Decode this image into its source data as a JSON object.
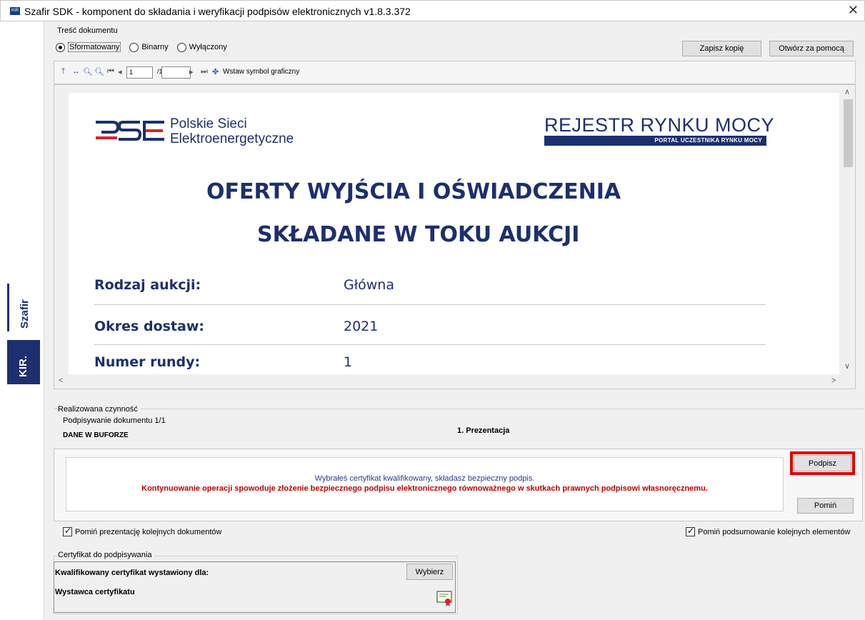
{
  "window": {
    "title": "Szafir SDK - komponent do składania i weryfikacji podpisów elektronicznych v1.8.3.372",
    "icon_label": "KIR"
  },
  "brand": {
    "szafir": "Szafir",
    "kir": "KIR."
  },
  "document_content": {
    "group_label": "Treść dokumentu",
    "modes": [
      {
        "label": "Sformatowany",
        "selected": true
      },
      {
        "label": "Binarny",
        "selected": false
      },
      {
        "label": "Wyłączony",
        "selected": false
      }
    ],
    "save_copy_label": "Zapisz kopię",
    "open_with_label": "Otwórz za pomocą"
  },
  "toolbar": {
    "page_current": "1",
    "page_total": "/1",
    "insert_symbol_label": "Wstaw symbol graficzny"
  },
  "document": {
    "pse_line1": "Polskie Sieci",
    "pse_line2": "Elektroenergetyczne",
    "rrm_title": "REJESTR RYNKU MOCY",
    "rrm_subtitle": "PORTAL UCZESTNIKA RYNKU MOCY",
    "heading1": "OFERTY WYJŚCIA I OŚWIADCZENIA",
    "heading2": "SKŁADANE W TOKU AUKCJI",
    "rows": [
      {
        "label": "Rodzaj aukcji:",
        "value": "Główna"
      },
      {
        "label": "Okres dostaw:",
        "value": "2021"
      },
      {
        "label": "Numer rundy:",
        "value": "1"
      }
    ]
  },
  "activity": {
    "group_label": "Realizowana czynność",
    "progress_text": "Podpisywanie dokumentu 1/1",
    "buffer_label": "DANE W BUFORZE",
    "step_label": "1. Prezentacja",
    "message_line1": "Wybrałeś certyfikat kwalifikowany, składasz bezpieczny podpis.",
    "message_line2": "Kontynuowanie operacji spowoduje złożenie bezpiecznego podpisu elektronicznego równoważnego w skutkach prawnych podpisowi własnoręcznemu.",
    "sign_label": "Podpisz",
    "skip_label": "Pomiń"
  },
  "options": {
    "skip_presentation_label": "Pomiń prezentację kolejnych dokumentów",
    "skip_presentation_checked": true,
    "skip_summary_label": "Pomiń podsumowanie kolejnych elementów",
    "skip_summary_checked": true
  },
  "certificate": {
    "group_label": "Certyfikat do podpisywania",
    "issued_for_label": "Kwalifikowany certyfikat wystawiony dla:",
    "issuer_label": "Wystawca certyfikatu",
    "choose_label": "Wybierz"
  },
  "colors": {
    "brand_navy": "#1d2f6e",
    "warning_red": "#c00000",
    "highlight_red": "#e00000"
  }
}
